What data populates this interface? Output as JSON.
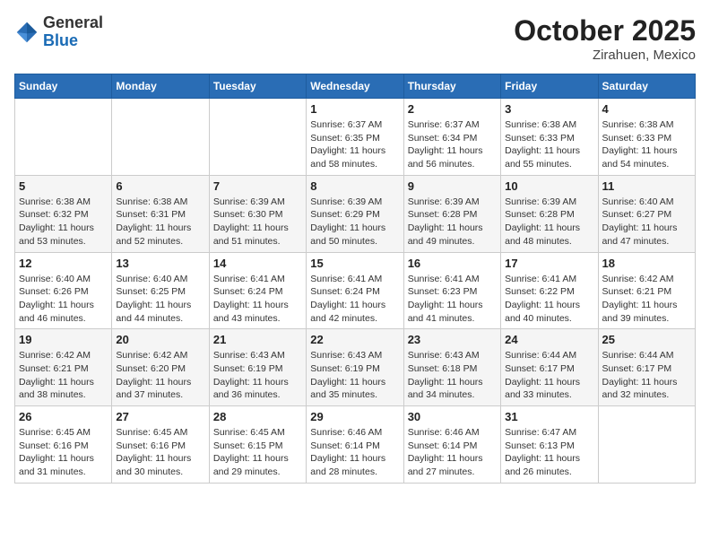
{
  "header": {
    "logo_general": "General",
    "logo_blue": "Blue",
    "month_year": "October 2025",
    "location": "Zirahuen, Mexico"
  },
  "days_of_week": [
    "Sunday",
    "Monday",
    "Tuesday",
    "Wednesday",
    "Thursday",
    "Friday",
    "Saturday"
  ],
  "weeks": [
    [
      {
        "day": "",
        "info": ""
      },
      {
        "day": "",
        "info": ""
      },
      {
        "day": "",
        "info": ""
      },
      {
        "day": "1",
        "info": "Sunrise: 6:37 AM\nSunset: 6:35 PM\nDaylight: 11 hours\nand 58 minutes."
      },
      {
        "day": "2",
        "info": "Sunrise: 6:37 AM\nSunset: 6:34 PM\nDaylight: 11 hours\nand 56 minutes."
      },
      {
        "day": "3",
        "info": "Sunrise: 6:38 AM\nSunset: 6:33 PM\nDaylight: 11 hours\nand 55 minutes."
      },
      {
        "day": "4",
        "info": "Sunrise: 6:38 AM\nSunset: 6:33 PM\nDaylight: 11 hours\nand 54 minutes."
      }
    ],
    [
      {
        "day": "5",
        "info": "Sunrise: 6:38 AM\nSunset: 6:32 PM\nDaylight: 11 hours\nand 53 minutes."
      },
      {
        "day": "6",
        "info": "Sunrise: 6:38 AM\nSunset: 6:31 PM\nDaylight: 11 hours\nand 52 minutes."
      },
      {
        "day": "7",
        "info": "Sunrise: 6:39 AM\nSunset: 6:30 PM\nDaylight: 11 hours\nand 51 minutes."
      },
      {
        "day": "8",
        "info": "Sunrise: 6:39 AM\nSunset: 6:29 PM\nDaylight: 11 hours\nand 50 minutes."
      },
      {
        "day": "9",
        "info": "Sunrise: 6:39 AM\nSunset: 6:28 PM\nDaylight: 11 hours\nand 49 minutes."
      },
      {
        "day": "10",
        "info": "Sunrise: 6:39 AM\nSunset: 6:28 PM\nDaylight: 11 hours\nand 48 minutes."
      },
      {
        "day": "11",
        "info": "Sunrise: 6:40 AM\nSunset: 6:27 PM\nDaylight: 11 hours\nand 47 minutes."
      }
    ],
    [
      {
        "day": "12",
        "info": "Sunrise: 6:40 AM\nSunset: 6:26 PM\nDaylight: 11 hours\nand 46 minutes."
      },
      {
        "day": "13",
        "info": "Sunrise: 6:40 AM\nSunset: 6:25 PM\nDaylight: 11 hours\nand 44 minutes."
      },
      {
        "day": "14",
        "info": "Sunrise: 6:41 AM\nSunset: 6:24 PM\nDaylight: 11 hours\nand 43 minutes."
      },
      {
        "day": "15",
        "info": "Sunrise: 6:41 AM\nSunset: 6:24 PM\nDaylight: 11 hours\nand 42 minutes."
      },
      {
        "day": "16",
        "info": "Sunrise: 6:41 AM\nSunset: 6:23 PM\nDaylight: 11 hours\nand 41 minutes."
      },
      {
        "day": "17",
        "info": "Sunrise: 6:41 AM\nSunset: 6:22 PM\nDaylight: 11 hours\nand 40 minutes."
      },
      {
        "day": "18",
        "info": "Sunrise: 6:42 AM\nSunset: 6:21 PM\nDaylight: 11 hours\nand 39 minutes."
      }
    ],
    [
      {
        "day": "19",
        "info": "Sunrise: 6:42 AM\nSunset: 6:21 PM\nDaylight: 11 hours\nand 38 minutes."
      },
      {
        "day": "20",
        "info": "Sunrise: 6:42 AM\nSunset: 6:20 PM\nDaylight: 11 hours\nand 37 minutes."
      },
      {
        "day": "21",
        "info": "Sunrise: 6:43 AM\nSunset: 6:19 PM\nDaylight: 11 hours\nand 36 minutes."
      },
      {
        "day": "22",
        "info": "Sunrise: 6:43 AM\nSunset: 6:19 PM\nDaylight: 11 hours\nand 35 minutes."
      },
      {
        "day": "23",
        "info": "Sunrise: 6:43 AM\nSunset: 6:18 PM\nDaylight: 11 hours\nand 34 minutes."
      },
      {
        "day": "24",
        "info": "Sunrise: 6:44 AM\nSunset: 6:17 PM\nDaylight: 11 hours\nand 33 minutes."
      },
      {
        "day": "25",
        "info": "Sunrise: 6:44 AM\nSunset: 6:17 PM\nDaylight: 11 hours\nand 32 minutes."
      }
    ],
    [
      {
        "day": "26",
        "info": "Sunrise: 6:45 AM\nSunset: 6:16 PM\nDaylight: 11 hours\nand 31 minutes."
      },
      {
        "day": "27",
        "info": "Sunrise: 6:45 AM\nSunset: 6:16 PM\nDaylight: 11 hours\nand 30 minutes."
      },
      {
        "day": "28",
        "info": "Sunrise: 6:45 AM\nSunset: 6:15 PM\nDaylight: 11 hours\nand 29 minutes."
      },
      {
        "day": "29",
        "info": "Sunrise: 6:46 AM\nSunset: 6:14 PM\nDaylight: 11 hours\nand 28 minutes."
      },
      {
        "day": "30",
        "info": "Sunrise: 6:46 AM\nSunset: 6:14 PM\nDaylight: 11 hours\nand 27 minutes."
      },
      {
        "day": "31",
        "info": "Sunrise: 6:47 AM\nSunset: 6:13 PM\nDaylight: 11 hours\nand 26 minutes."
      },
      {
        "day": "",
        "info": ""
      }
    ]
  ]
}
